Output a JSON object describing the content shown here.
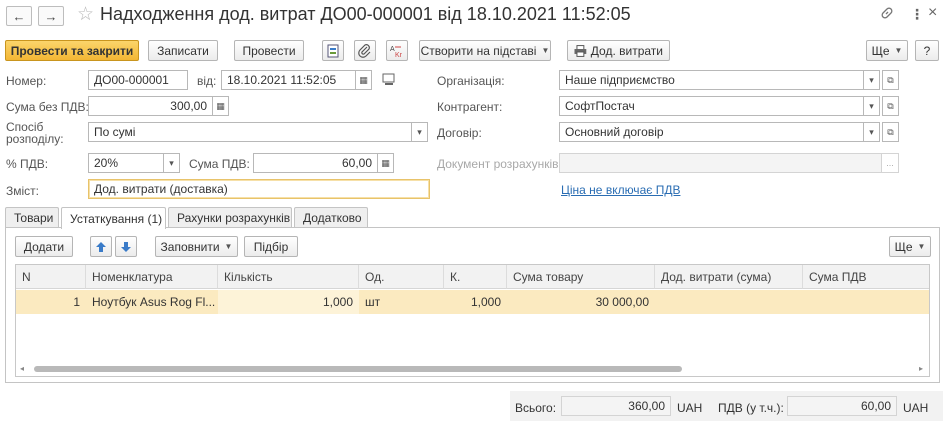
{
  "title": "Надходження дод. витрат ДО00-000001 від 18.10.2021 11:52:05",
  "icons": {
    "back": "←",
    "forward": "→",
    "favorite": "☆",
    "link": "🔗",
    "more": "⋮",
    "close": "×",
    "calendar": "▦",
    "dropdown": "▾",
    "open": "⧉",
    "ellipsis": "...",
    "up": "⬆",
    "down": "⬇",
    "printer": "🖶",
    "scroll_right": "▸",
    "scroll_left": "◂"
  },
  "toolbar": {
    "post_and_close": "Провести та закрити",
    "write": "Записати",
    "post": "Провести",
    "create_based": "Створити на підставі",
    "add_costs": "Дод. витрати",
    "more": "Ще",
    "help": "?"
  },
  "form": {
    "number_label": "Номер:",
    "number_value": "ДО00-000001",
    "date_label": "від:",
    "date_value": "18.10.2021 11:52:05",
    "org_label": "Організація:",
    "org_value": "Наше підприємство",
    "sum_label": "Сума без ПДВ:",
    "sum_value": "300,00",
    "counterparty_label": "Контрагент:",
    "counterparty_value": "СофтПостач",
    "distribution_label_1": "Спосіб",
    "distribution_label_2": "розподілу:",
    "distribution_value": "По сумі",
    "contract_label": "Договір:",
    "contract_value": "Основний договір",
    "vat_rate_label": "% ПДВ:",
    "vat_rate_value": "20%",
    "vat_sum_label": "Сума ПДВ:",
    "vat_sum_value": "60,00",
    "settlement_doc_label": "Документ розрахунків:",
    "settlement_doc_value": "",
    "content_label": "Зміст:",
    "content_value": "Дод. витрати (доставка)",
    "price_link": "Ціна не включає ПДВ"
  },
  "tabs": [
    {
      "label": "Товари"
    },
    {
      "label": "Устаткування (1)"
    },
    {
      "label": "Рахунки розрахунків"
    },
    {
      "label": "Додатково"
    }
  ],
  "table_toolbar": {
    "add": "Додати",
    "fill": "Заповнити",
    "select": "Підбір",
    "more": "Ще"
  },
  "table": {
    "columns": [
      "N",
      "Номенклатура",
      "Кількість",
      "Од.",
      "К.",
      "Сума товару",
      "Дод. витрати (сума)",
      "Сума ПДВ"
    ],
    "rows": [
      [
        "1",
        "Ноутбук Asus Rog Fl...",
        "1,000",
        "шт",
        "1,000",
        "30 000,00",
        "",
        ""
      ]
    ]
  },
  "footer": {
    "total_label": "Всього:",
    "total_value": "360,00",
    "currency": "UAH",
    "vat_label": "ПДВ (у т.ч.):",
    "vat_value": "60,00",
    "vat_currency": "UAH"
  }
}
